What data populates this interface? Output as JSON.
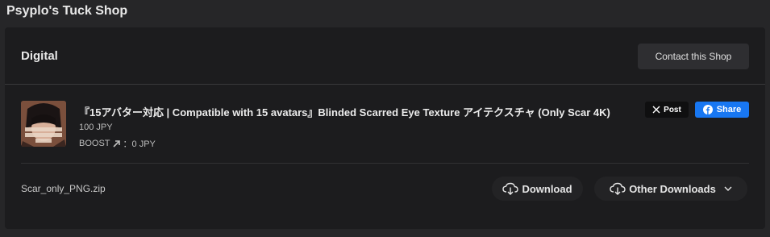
{
  "header": {
    "shop_title": "Psyplo's Tuck Shop"
  },
  "section": {
    "title": "Digital",
    "contact_label": "Contact this Shop"
  },
  "item": {
    "title": "『15アバター対応 | Compatible with 15 avatars』Blinded Scarred Eye Texture アイテクスチャ (Only Scar 4K)",
    "price": "100 JPY",
    "boost_label": "BOOST",
    "boost_value": "：0 JPY",
    "thumbnail_icon": "product-thumbnail",
    "post_label": "Post",
    "share_label": "Share"
  },
  "file": {
    "name": "Scar_only_PNG.zip",
    "download_label": "Download",
    "other_downloads_label": "Other Downloads"
  },
  "colors": {
    "background": "#262628",
    "card": "#1c1c1e",
    "share_blue": "#1877f2"
  }
}
